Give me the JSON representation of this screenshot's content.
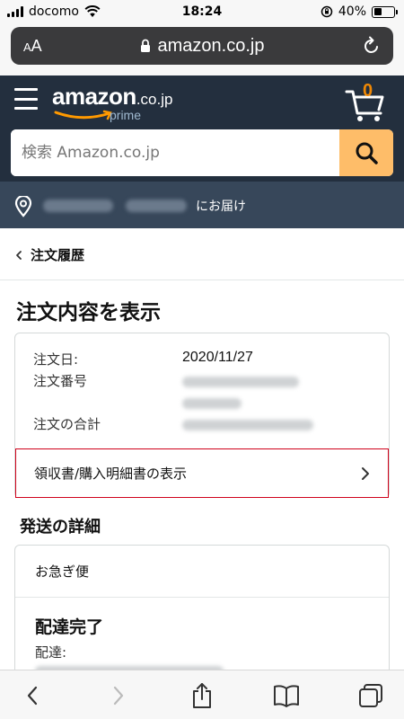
{
  "status_bar": {
    "carrier": "docomo",
    "time": "18:24",
    "battery_percent": "40%",
    "battery_level": 0.4
  },
  "browser": {
    "aa_label_small": "A",
    "aa_label_large": "A",
    "url": "amazon.co.jp"
  },
  "header": {
    "logo_main": "amazon",
    "logo_tld": ".co.jp",
    "logo_sub": "prime",
    "cart_count": "0",
    "search_placeholder": "検索 Amazon.co.jp",
    "deliver_to_label": "にお届け"
  },
  "breadcrumb": {
    "label": "注文履歴"
  },
  "page": {
    "title": "注文内容を表示"
  },
  "order": {
    "date_label": "注文日:",
    "date_value": "2020/11/27",
    "number_label": "注文番号",
    "total_label": "注文の合計",
    "receipt_link": "領収書/購入明細書の表示"
  },
  "shipping": {
    "section_title": "発送の詳細",
    "method": "お急ぎ便",
    "status": "配達完了",
    "delivery_label": "配達:"
  },
  "colors": {
    "header_bg": "#232f3e",
    "delivery_bar_bg": "#37475a",
    "search_button": "#febd69",
    "cart_count": "#f08804",
    "highlight_border": "#d0021b"
  }
}
